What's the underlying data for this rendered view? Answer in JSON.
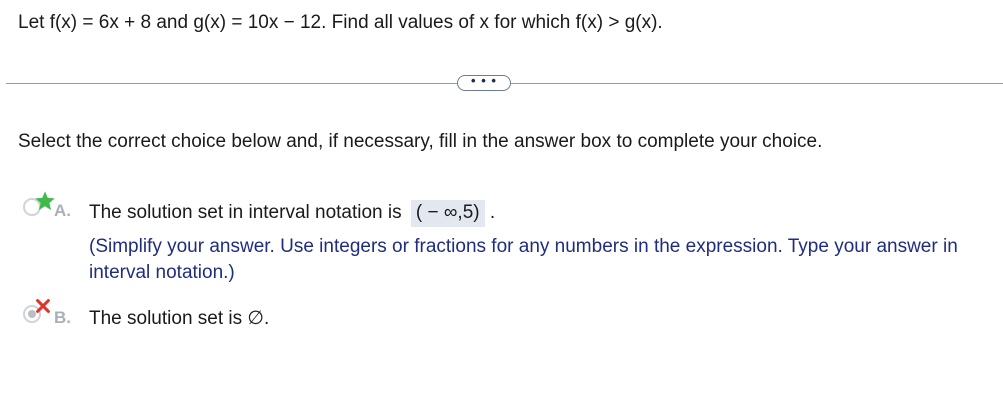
{
  "question": {
    "text": "Let f(x) = 6x + 8 and g(x) = 10x − 12. Find all values of x for which f(x) > g(x)."
  },
  "more_button": {
    "label": "• • •"
  },
  "instruction": {
    "text": "Select the correct choice below and, if necessary, fill in the answer box to complete your choice."
  },
  "choices": [
    {
      "letter": "A.",
      "text": "The solution set in interval notation is",
      "answer": "( − ∞,5)",
      "after": ".",
      "hint": "(Simplify your answer. Use integers or fractions for any numbers in the expression. Type your answer in interval notation.)",
      "mark": "star-icon",
      "mark_color": "#3fb94a",
      "selected": false
    },
    {
      "letter": "B.",
      "text": "The solution set is ∅.",
      "mark": "x-icon",
      "mark_color": "#e0332a",
      "selected": true
    }
  ]
}
